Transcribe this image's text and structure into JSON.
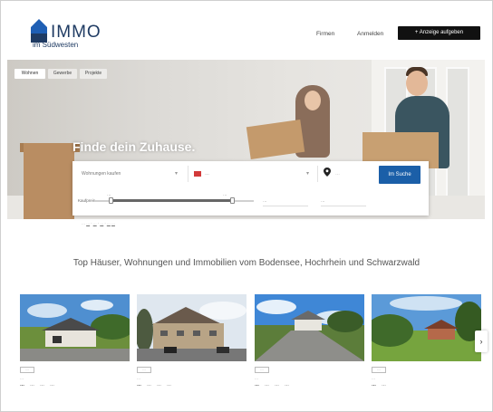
{
  "header": {
    "logo_word": "IMMO",
    "logo_sub": "im Südwesten",
    "nav": [
      "Firmen",
      "Anmelden"
    ],
    "cta": "+ Anzeige aufgeben"
  },
  "hero": {
    "tabs": [
      "Wohnen",
      "Gewerbe",
      "Projekte"
    ],
    "title": "Finde dein Zuhause."
  },
  "search": {
    "type_select": "Wohnungen kaufen",
    "region_select": "…",
    "location_placeholder": "…",
    "button": "Im Suche",
    "price_label": "Kaufpreis",
    "price_min": "…",
    "price_max": "…",
    "rooms_select": "…",
    "area_select": "…"
  },
  "suggestions": {
    "prefix": "…",
    "links": [
      "…",
      "…",
      "…",
      "…",
      "…"
    ]
  },
  "tagline": "Top Häuser, Wohnungen und Immobilien vom Bodensee, Hochrhein und Schwarzwald",
  "listings": [
    {
      "badge": "…",
      "desc": "…",
      "price": "…",
      "area": "…",
      "plot": "…",
      "rooms": "…"
    },
    {
      "badge": "…",
      "desc": "…",
      "price": "…",
      "area": "…",
      "plot": "…",
      "rooms": "…"
    },
    {
      "badge": "…",
      "desc": "…",
      "price": "…",
      "area": "…",
      "plot": "…",
      "rooms": "…"
    },
    {
      "badge": "…",
      "desc": "…",
      "price": "…",
      "area": "…",
      "plot": "…",
      "rooms": "…"
    }
  ],
  "icons": {
    "logo": "house-icon",
    "region": "flag-icon",
    "location": "map-pin-icon",
    "next": "chevron-right-icon"
  },
  "colors": {
    "brand_blue": "#1f3b63",
    "search_button": "#1b5fa8",
    "cta_black": "#111111"
  }
}
